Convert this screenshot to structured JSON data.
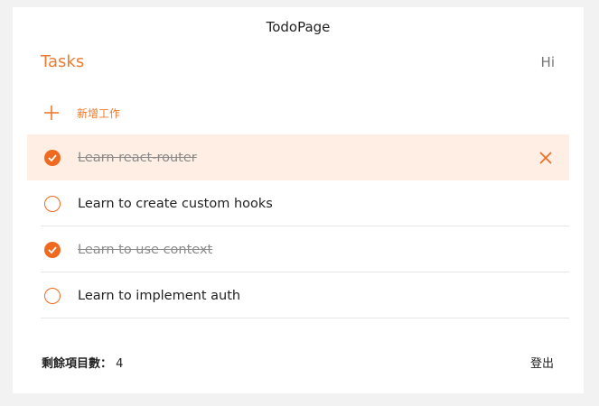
{
  "app": {
    "title": "TodoPage",
    "accent": "#ef6a1f",
    "hover_bg": "#ffeee3"
  },
  "header": {
    "tasks_title": "Tasks",
    "greeting": "Hi"
  },
  "add": {
    "icon": "plus-icon",
    "label": "新增工作"
  },
  "todos": [
    {
      "text": "Learn react-router",
      "done": true,
      "hovered": true
    },
    {
      "text": "Learn to create custom hooks",
      "done": false,
      "hovered": false
    },
    {
      "text": "Learn to use context",
      "done": true,
      "hovered": false
    },
    {
      "text": "Learn to implement auth",
      "done": false,
      "hovered": false
    }
  ],
  "footer": {
    "remaining_label": "剩餘項目數：",
    "remaining_count": "4",
    "logout_label": "登出"
  }
}
